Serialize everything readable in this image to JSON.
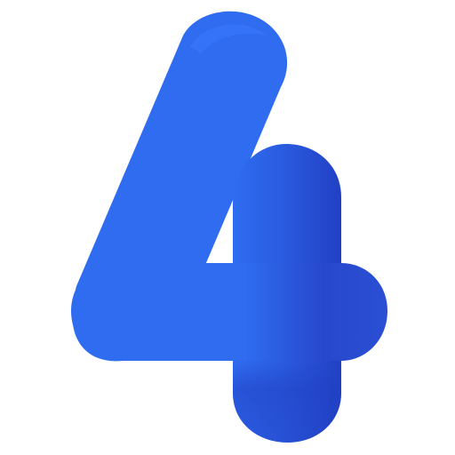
{
  "logo": {
    "icon_name": "digit-four-logo-icon",
    "colors": {
      "primary": "#2f6cf0",
      "light": "#3372f6",
      "shade": "#2240c4",
      "background": "#ffffff"
    }
  }
}
